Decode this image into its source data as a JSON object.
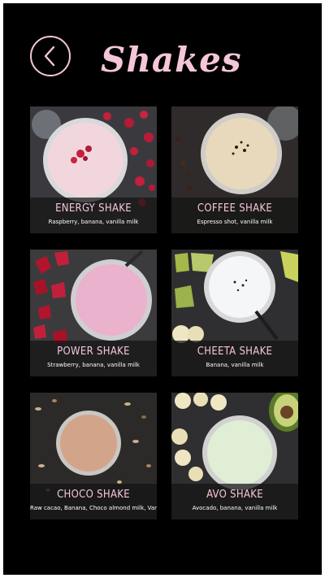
{
  "header": {
    "title": "Shakes",
    "back_icon": "chevron-left-icon"
  },
  "colors": {
    "accent": "#f4c6d9",
    "background": "#000000"
  },
  "shakes": [
    {
      "name": "ENERGY SHAKE",
      "description": "Raspberry, banana, vanilla milk"
    },
    {
      "name": "COFFEE SHAKE",
      "description": "Espresso shot, vanilla milk"
    },
    {
      "name": "POWER SHAKE",
      "description": "Strawberry, banana, vanilla milk"
    },
    {
      "name": "CHEETA SHAKE",
      "description": "Banana, vanilla milk"
    },
    {
      "name": "CHOCO SHAKE",
      "description": "Raw cacao, Banana, Choco almond milk, Vanilla milk"
    },
    {
      "name": "AVO SHAKE",
      "description": "Avocado, banana, vanilla milk"
    }
  ]
}
